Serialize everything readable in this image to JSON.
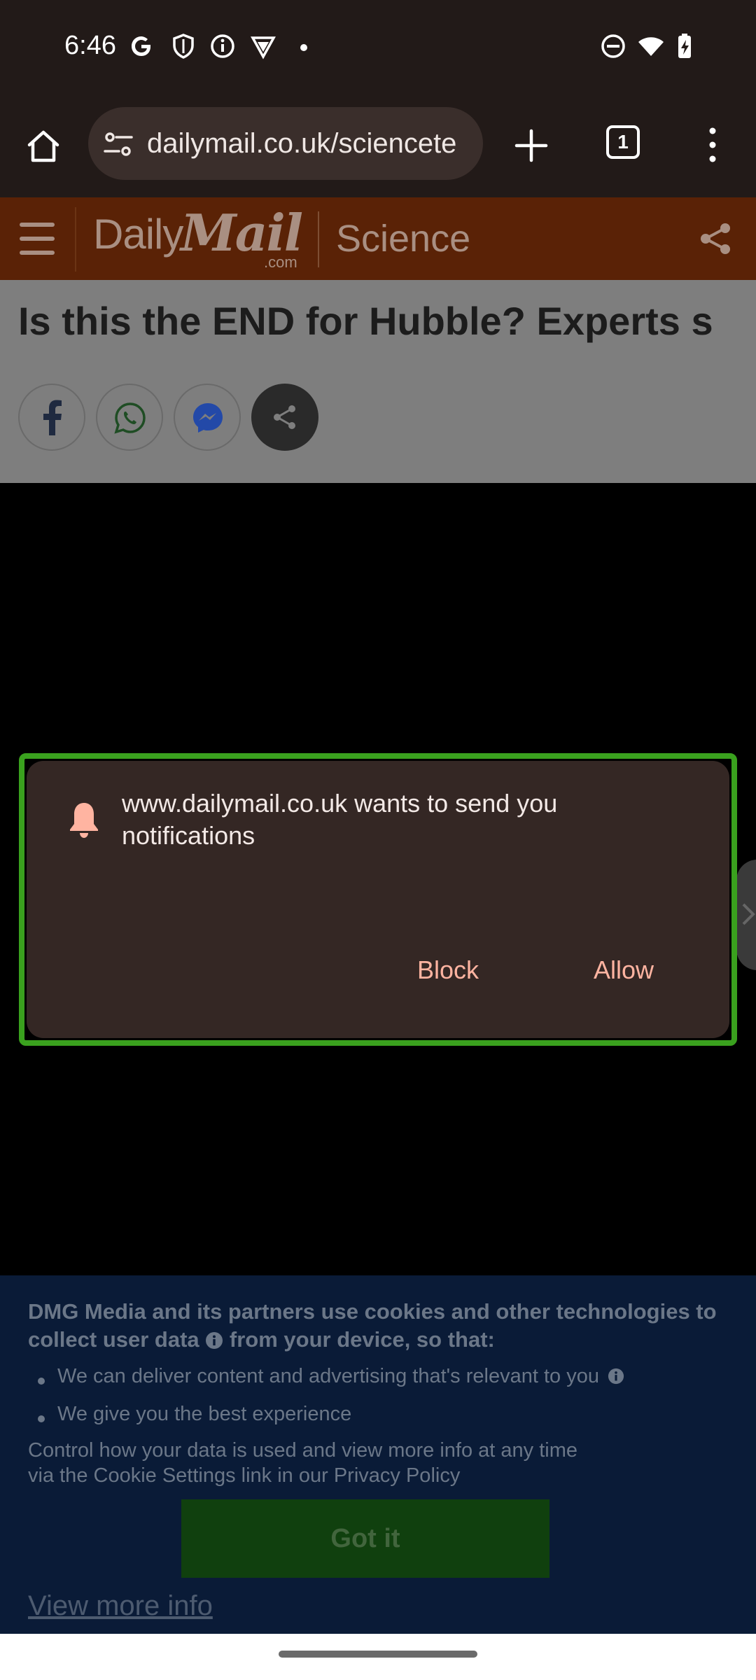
{
  "status_bar": {
    "time": "6:46",
    "left_icons": [
      "google-g-icon",
      "shield-icon",
      "info-icon",
      "vpn-icon",
      "dot-icon"
    ],
    "right_icons": [
      "do-not-disturb-icon",
      "wifi-icon",
      "battery-charging-icon"
    ]
  },
  "browser": {
    "url": "dailymail.co.uk/sciencete",
    "tab_count": "1"
  },
  "site_header": {
    "logo_daily": "Daily",
    "logo_mail": "Mail",
    "logo_com": ".com",
    "section": "Science"
  },
  "article": {
    "headline": "Is this the END for Hubble? Experts s"
  },
  "notification_dialog": {
    "message": "www.dailymail.co.uk wants to send you notifications",
    "block_label": "Block",
    "allow_label": "Allow",
    "accent_color": "#ffb4a1"
  },
  "cookie_banner": {
    "heading_part1": "DMG Media and its partners use cookies and other technologies to collect user data",
    "heading_part2": " from your device, so that:",
    "items": [
      "We can deliver content and advertising that's relevant to you",
      "We give you the best experience"
    ],
    "control_text": "Control how your data is used and view more info at any time via the Cookie Settings link in our Privacy Policy",
    "got_it_label": "Got it",
    "view_more_label": "View more info"
  }
}
